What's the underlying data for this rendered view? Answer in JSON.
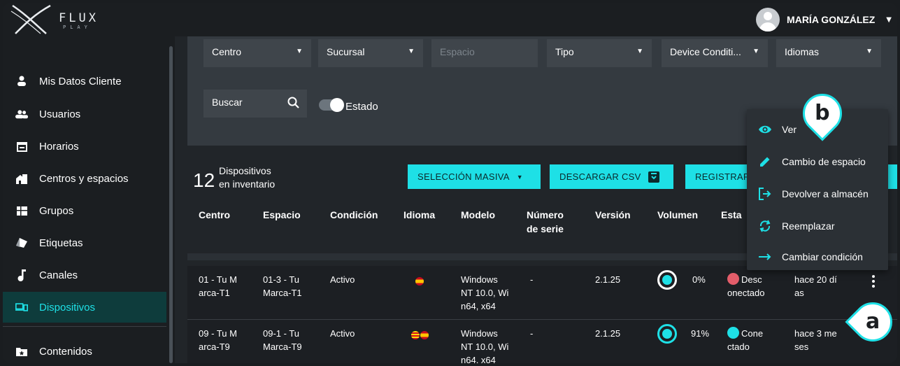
{
  "app": {
    "logo_text": "FLUX",
    "logo_sub": "PLAY"
  },
  "user": {
    "name": "MARÍA GONZÁLEZ"
  },
  "sidebar": {
    "items": [
      {
        "label": "Mis Datos Cliente",
        "icon": "person-icon"
      },
      {
        "label": "Usuarios",
        "icon": "users-icon"
      },
      {
        "label": "Horarios",
        "icon": "calendar-icon"
      },
      {
        "label": "Centros y espacios",
        "icon": "building-icon"
      },
      {
        "label": "Grupos",
        "icon": "groups-icon"
      },
      {
        "label": "Etiquetas",
        "icon": "tags-icon"
      },
      {
        "label": "Canales",
        "icon": "music-note-icon"
      },
      {
        "label": "Dispositivos",
        "icon": "devices-icon",
        "active": true
      },
      {
        "label": "Contenidos",
        "icon": "folder-star-icon"
      }
    ]
  },
  "filters": {
    "centro": "Centro",
    "sucursal": "Sucursal",
    "espacio": "Espacio",
    "tipo": "Tipo",
    "device_condition": "Device Conditi...",
    "idiomas": "Idiomas",
    "buscar_placeholder": "Buscar",
    "estado_label": "Estado"
  },
  "inventory": {
    "count": "12",
    "count_line1": "Dispositivos",
    "count_line2": "en inventario"
  },
  "actions": {
    "mass_select": "SELECCIÓN MASIVA",
    "download_csv": "DESCARGAR CSV",
    "register": "REGISTRAR"
  },
  "table": {
    "headers": {
      "centro": "Centro",
      "espacio": "Espacio",
      "condicion": "Condición",
      "idioma": "Idioma",
      "modelo": "Modelo",
      "numero_serie_1": "Número",
      "numero_serie_2": "de serie",
      "version": "Versión",
      "volumen": "Volumen",
      "estado": "Esta"
    },
    "rows": [
      {
        "centro_1": "01 - Tu M",
        "centro_2": "arca-T1",
        "espacio_1": "01-3 - Tu",
        "espacio_2": "Marca-T1",
        "condicion": "Activo",
        "idiomas": [
          "es"
        ],
        "modelo_1": "Windows",
        "modelo_2": "NT 10.0, Wi",
        "modelo_3": "n64, x64",
        "serie": "-",
        "version": "2.1.25",
        "volumen": "0%",
        "estado_1": "Desc",
        "estado_2": "onectado",
        "estado_color": "#e35d6a",
        "ultimo_1": "hace 20 dí",
        "ultimo_2": "as"
      },
      {
        "centro_1": "09 - Tu M",
        "centro_2": "arca-T9",
        "espacio_1": "09-1 - Tu",
        "espacio_2": "Marca-T9",
        "condicion": "Activo",
        "idiomas": [
          "ca",
          "es"
        ],
        "modelo_1": "Windows",
        "modelo_2": "NT 10.0, Wi",
        "modelo_3": "n64, x64",
        "serie": "-",
        "version": "2.1.25",
        "volumen": "91%",
        "estado_1": "Cone",
        "estado_2": "ctado",
        "estado_color": "#1ee0e6",
        "ultimo_1": "hace 3 me",
        "ultimo_2": "ses"
      }
    ]
  },
  "menu": {
    "items": [
      {
        "label": "Ver",
        "icon": "eye-icon"
      },
      {
        "label": "Cambio de espacio",
        "icon": "pencil-icon"
      },
      {
        "label": "Devolver a almacén",
        "icon": "exit-icon"
      },
      {
        "label": "Reemplazar",
        "icon": "replace-icon"
      },
      {
        "label": "Cambiar condición",
        "icon": "arrow-right-icon"
      }
    ]
  },
  "markers": {
    "a": "a",
    "b": "b"
  },
  "colors": {
    "accent": "#1ee0e6",
    "background": "#212529",
    "panel": "#343a40",
    "sidebar_active": "#0e3c3c"
  }
}
